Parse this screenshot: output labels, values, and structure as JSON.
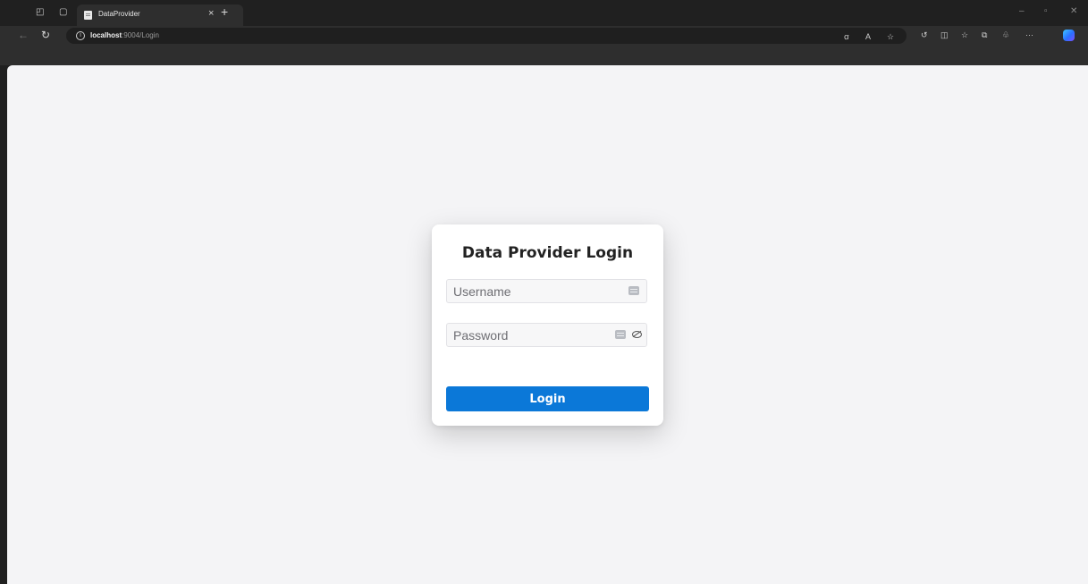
{
  "browser": {
    "tab": {
      "title": "DataProvider",
      "close_glyph": "×"
    },
    "new_tab_glyph": "+",
    "url_host": "localhost",
    "url_path": ":9004/Login",
    "toolbar_icons": [
      "read-aloud-icon",
      "aa-text-icon",
      "favorite-star-icon",
      "refresh-extension-icon",
      "split-screen-icon",
      "favorites-icon",
      "collections-icon",
      "extensions-icon",
      "more-icon",
      "copilot-icon"
    ],
    "window_controls": {
      "minimize": "–",
      "restore": "▫",
      "close": "✕"
    }
  },
  "login": {
    "title": "Data Provider Login",
    "username_placeholder": "Username",
    "password_placeholder": "Password",
    "submit_label": "Login"
  },
  "colors": {
    "primary_button": "#0b78d8",
    "page_background": "#f4f4f6",
    "browser_chrome": "#202020"
  }
}
